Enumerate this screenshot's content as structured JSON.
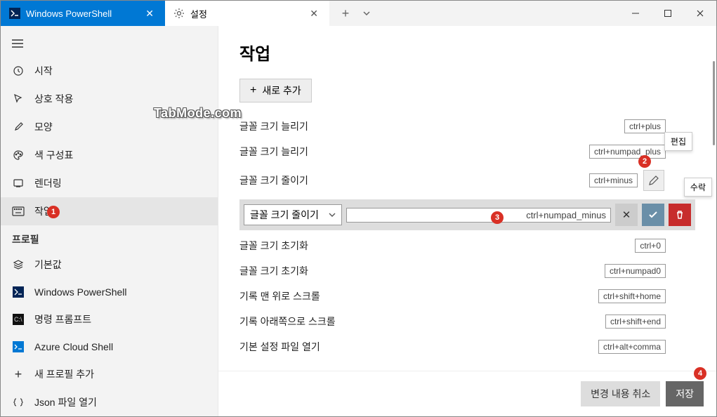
{
  "tabs": {
    "powershell": "Windows PowerShell",
    "settings": "설정"
  },
  "sidebar": {
    "items": [
      {
        "label": "시작"
      },
      {
        "label": "상호 작용"
      },
      {
        "label": "모양"
      },
      {
        "label": "색 구성표"
      },
      {
        "label": "렌더링"
      },
      {
        "label": "작업"
      }
    ],
    "profile_heading": "프로필",
    "profiles": [
      {
        "label": "기본값"
      },
      {
        "label": "Windows PowerShell"
      },
      {
        "label": "명령 프롬프트"
      },
      {
        "label": "Azure Cloud Shell"
      }
    ],
    "add_profile": "새 프로필 추가",
    "open_json": "Json 파일 열기"
  },
  "main": {
    "title": "작업",
    "add_new": "새로 추가",
    "actions": [
      {
        "name": "글꼴 크기 늘리기",
        "key": "ctrl+plus"
      },
      {
        "name": "글꼴 크기 늘리기",
        "key": "ctrl+numpad_plus"
      },
      {
        "name": "글꼴 크기 줄이기",
        "key": "ctrl+minus"
      },
      {
        "name": "글꼴 크기 줄이기",
        "key": "ctrl+numpad_minus"
      },
      {
        "name": "글꼴 크기 초기화",
        "key": "ctrl+0"
      },
      {
        "name": "글꼴 크기 초기화",
        "key": "ctrl+numpad0"
      },
      {
        "name": "기록 맨 위로 스크롤",
        "key": "ctrl+shift+home"
      },
      {
        "name": "기록 아래쪽으로 스크롤",
        "key": "ctrl+shift+end"
      },
      {
        "name": "기본 설정 파일 열기",
        "key": "ctrl+alt+comma"
      }
    ],
    "edit_tooltip": "편집",
    "accept_tooltip": "수락"
  },
  "footer": {
    "discard": "변경 내용 취소",
    "save": "저장"
  },
  "badges": {
    "b1": "1",
    "b2": "2",
    "b3": "3",
    "b4": "4"
  },
  "watermark": "TabMode.com"
}
